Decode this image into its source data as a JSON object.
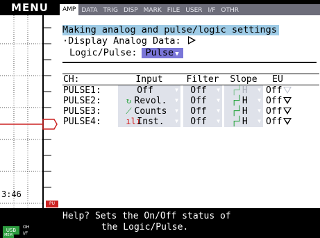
{
  "menu": {
    "title": "MENU"
  },
  "tabs": [
    {
      "label": "AMP",
      "active": true
    },
    {
      "label": "DATA"
    },
    {
      "label": "TRIG"
    },
    {
      "label": "DISP"
    },
    {
      "label": "MARK"
    },
    {
      "label": "FILE"
    },
    {
      "label": "USER"
    },
    {
      "label": "I/F"
    },
    {
      "label": "OTHR"
    }
  ],
  "header": {
    "title": "Making analog and pulse/logic settings",
    "display_analog_label": "·Display Analog Data:",
    "mode_label": "Logic/Pulse:",
    "mode_value": "Pulse"
  },
  "table": {
    "columns": {
      "ch": "CH:",
      "input": "Input",
      "filter": "Filter",
      "slope": "Slope",
      "eu": "EU"
    },
    "rows": [
      {
        "ch": "PULSE1:",
        "input": "Off",
        "icon": "",
        "filter": "Off",
        "slope_icon": "rising-edge-icon",
        "slope": "H",
        "eu": "Off",
        "enabled": false
      },
      {
        "ch": "PULSE2:",
        "input": "Revol.",
        "icon": "revolution-icon",
        "filter": "Off",
        "slope_icon": "rising-edge-icon",
        "slope": "H",
        "eu": "Off",
        "enabled": true
      },
      {
        "ch": "PULSE3:",
        "input": "Counts",
        "icon": "counts-icon",
        "filter": "Off",
        "slope_icon": "rising-edge-icon",
        "slope": "H",
        "eu": "Off",
        "enabled": true
      },
      {
        "ch": "PULSE4:",
        "input": "Inst.",
        "icon": "instant-icon",
        "filter": "Off",
        "slope_icon": "rising-edge-icon",
        "slope": "H",
        "eu": "Off",
        "enabled": true
      }
    ]
  },
  "help": {
    "line1": "Help? Sets the On/Off status of",
    "line2": "the Logic/Pulse."
  },
  "status": {
    "time": "3:46",
    "ch_badge": "PU",
    "usb": "USB",
    "mem": "MEM",
    "oh": "OH",
    "if": "I/F"
  },
  "colors": {
    "title_highlight": "#9ecbe6",
    "mode_select": "#7a76d8",
    "tab_bar": "#6d6d7a",
    "green_badge": "#2c9b3e",
    "red_trace": "#cc2222"
  }
}
